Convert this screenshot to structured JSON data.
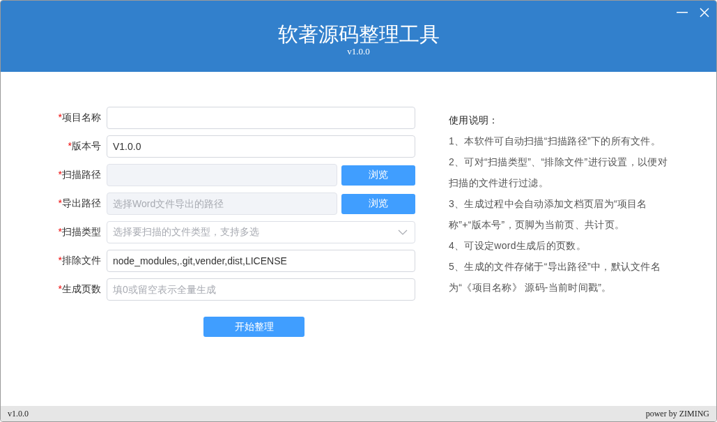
{
  "window": {
    "title": "软著源码整理工具",
    "version": "v1.0.0"
  },
  "form": {
    "fields": [
      {
        "kind": "text",
        "required_mark": "*",
        "label": "项目名称",
        "disabled": false
      },
      {
        "kind": "text",
        "required_mark": "*",
        "label": "版本号",
        "value": "V1.0.0",
        "disabled": false
      },
      {
        "kind": "browse",
        "required_mark": "*",
        "label": "扫描路径",
        "disabled": true,
        "button": "浏览"
      },
      {
        "kind": "browse",
        "required_mark": "*",
        "label": "导出路径",
        "placeholder": "选择Word文件导出的路径",
        "disabled": true,
        "button": "浏览"
      },
      {
        "kind": "select",
        "required_mark": "*",
        "label": "扫描类型",
        "placeholder": "选择要扫描的文件类型，支持多选",
        "disabled": false
      },
      {
        "kind": "text",
        "required_mark": "*",
        "label": "排除文件",
        "value": "node_modules,.git,vender,dist,LICENSE",
        "disabled": false
      },
      {
        "kind": "text",
        "required_mark": "*",
        "label": "生成页数",
        "placeholder": "填0或留空表示全量生成",
        "disabled": false
      }
    ],
    "submit": "开始整理"
  },
  "help": {
    "title": "使用说明：",
    "items": [
      "1、本软件可自动扫描“扫描路径”下的所有文件。",
      "2、可对“扫描类型”、“排除文件”进行设置，以便对扫描的文件进行过滤。",
      "3、生成过程中会自动添加文档页眉为“项目名称”+“版本号”，页脚为当前页、共计页。",
      "4、可设定word生成后的页数。",
      "5、生成的文件存储于“导出路径”中，默认文件名为“《项目名称》 源码-当前时间戳”。"
    ]
  },
  "status_bar": {
    "left": "v1.0.0",
    "right": "power by ZIMING"
  }
}
